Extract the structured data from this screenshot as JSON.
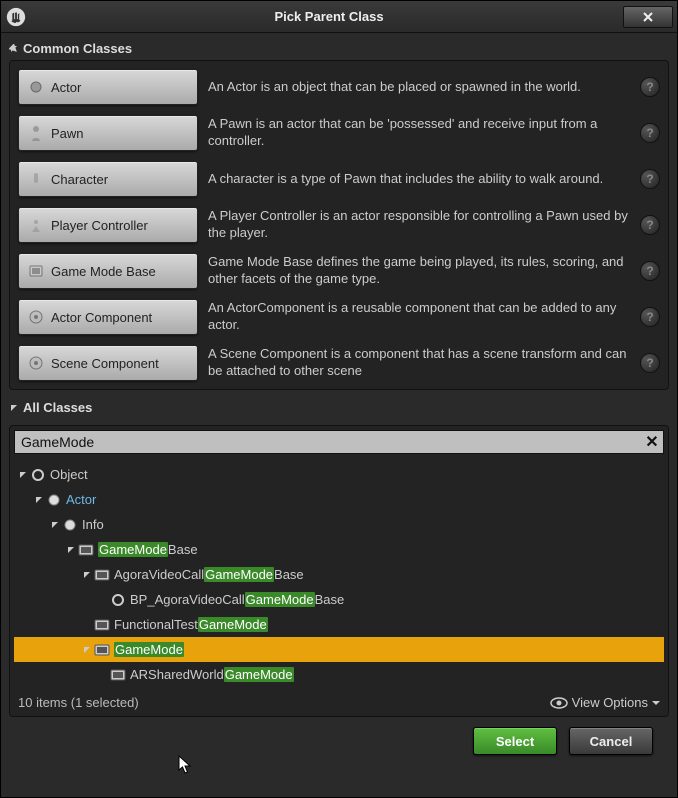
{
  "window": {
    "title": "Pick Parent Class"
  },
  "sections": {
    "common_label": "Common Classes",
    "all_label": "All Classes"
  },
  "common_classes": [
    {
      "name": "Actor",
      "desc": "An Actor is an object that can be placed or spawned in the world."
    },
    {
      "name": "Pawn",
      "desc": "A Pawn is an actor that can be 'possessed' and receive input from a controller."
    },
    {
      "name": "Character",
      "desc": "A character is a type of Pawn that includes the ability to walk around."
    },
    {
      "name": "Player Controller",
      "desc": "A Player Controller is an actor responsible for controlling a Pawn used by the player."
    },
    {
      "name": "Game Mode Base",
      "desc": "Game Mode Base defines the game being played, its rules, scoring, and other facets of the game type."
    },
    {
      "name": "Actor Component",
      "desc": "An ActorComponent is a reusable component that can be added to any actor."
    },
    {
      "name": "Scene Component",
      "desc": "A Scene Component is a component that has a scene transform and can be attached to other scene"
    }
  ],
  "search": {
    "value": "GameMode"
  },
  "tree": {
    "highlight": "GameMode",
    "items": [
      {
        "depth": 0,
        "label_parts": [
          "Object"
        ],
        "icon": "circle-empty",
        "expanded": true,
        "link": false
      },
      {
        "depth": 1,
        "label_parts": [
          "Actor"
        ],
        "icon": "circle-full",
        "expanded": true,
        "link": true
      },
      {
        "depth": 2,
        "label_parts": [
          "Info"
        ],
        "icon": "circle-full",
        "expanded": true,
        "link": false
      },
      {
        "depth": 3,
        "label_parts": [
          "",
          "GameMode",
          "Base"
        ],
        "icon": "cpp",
        "expanded": true,
        "link": false
      },
      {
        "depth": 4,
        "label_parts": [
          "AgoraVideoCall",
          "GameMode",
          "Base"
        ],
        "icon": "cpp",
        "expanded": true,
        "link": false
      },
      {
        "depth": 5,
        "label_parts": [
          "BP_AgoraVideoCall",
          "GameMode",
          "Base"
        ],
        "icon": "bp",
        "expanded": false,
        "link": false
      },
      {
        "depth": 4,
        "label_parts": [
          "FunctionalTest",
          "GameMode",
          ""
        ],
        "icon": "cpp",
        "expanded": false,
        "link": false
      },
      {
        "depth": 4,
        "label_parts": [
          "",
          "GameMode",
          ""
        ],
        "icon": "cpp",
        "expanded": true,
        "link": false,
        "selected": true
      },
      {
        "depth": 5,
        "label_parts": [
          "ARSharedWorld",
          "GameMode",
          ""
        ],
        "icon": "cpp",
        "expanded": false,
        "link": false
      }
    ]
  },
  "status": {
    "text": "10 items (1 selected)",
    "view_options": "View Options"
  },
  "footer": {
    "select": "Select",
    "cancel": "Cancel"
  }
}
